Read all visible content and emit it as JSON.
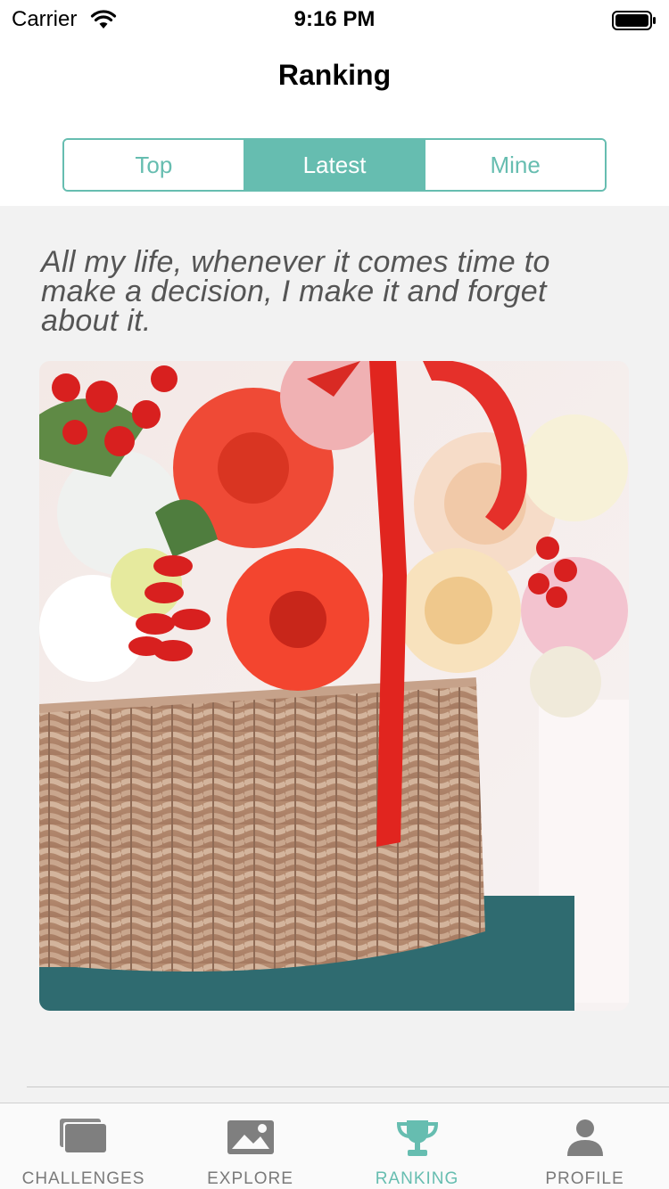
{
  "status_bar": {
    "carrier": "Carrier",
    "time": "9:16 PM"
  },
  "nav": {
    "title": "Ranking"
  },
  "segments": {
    "items": [
      "Top",
      "Latest",
      "Mine"
    ],
    "selected": "Latest"
  },
  "post": {
    "quote": "All my life, whenever it comes time to make a decision, I make it and forget about it.",
    "image": "flower-basket-photo"
  },
  "tab_bar": {
    "items": [
      {
        "label": "CHALLENGES",
        "icon": "cards-stack-icon"
      },
      {
        "label": "EXPLORE",
        "icon": "picture-icon"
      },
      {
        "label": "RANKING",
        "icon": "trophy-icon"
      },
      {
        "label": "PROFILE",
        "icon": "person-icon"
      }
    ],
    "selected": "RANKING"
  },
  "colors": {
    "accent": "#66bdb0",
    "inactive_tab": "#7a7a7a",
    "content_background": "#f2f2f2"
  }
}
